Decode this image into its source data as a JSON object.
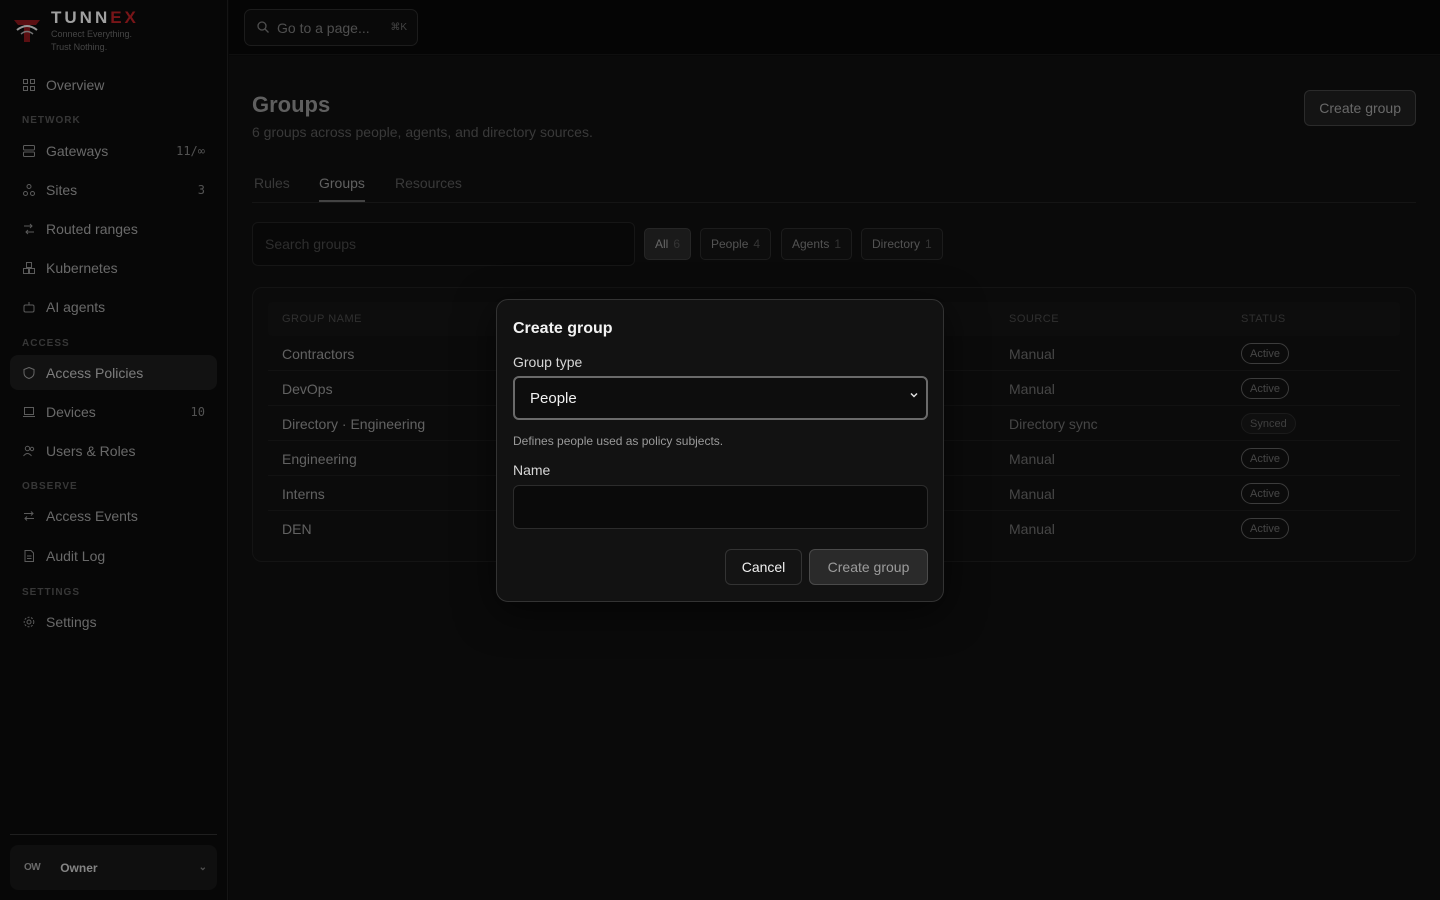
{
  "brand": {
    "name_prefix": "TUNN",
    "name_x": "EX",
    "tagline_1": "Connect Everything.",
    "tagline_2": "Trust Nothing.",
    "accent": "#a01c20"
  },
  "sidebar": {
    "overview": "Overview",
    "sections": {
      "network": "NETWORK",
      "access": "ACCESS",
      "observe": "OBSERVE",
      "settings": "SETTINGS"
    },
    "items": {
      "gateways": {
        "label": "Gateways",
        "count": "11/∞"
      },
      "sites": {
        "label": "Sites",
        "count": "3"
      },
      "routed": {
        "label": "Routed ranges"
      },
      "kubernetes": {
        "label": "Kubernetes"
      },
      "ai_agents": {
        "label": "AI agents"
      },
      "access_policies": {
        "label": "Access Policies"
      },
      "devices": {
        "label": "Devices",
        "count": "10"
      },
      "users_roles": {
        "label": "Users & Roles"
      },
      "access_events": {
        "label": "Access Events"
      },
      "audit_log": {
        "label": "Audit Log"
      },
      "settings": {
        "label": "Settings"
      }
    },
    "user": {
      "initials": "OW",
      "role": "Owner"
    }
  },
  "topbar": {
    "goto_placeholder": "Go to a page...",
    "goto_shortcut": "⌘K"
  },
  "page": {
    "title": "Groups",
    "subtitle": "6 groups across people, agents, and directory sources.",
    "create_button": "Create group",
    "tabs": [
      "Rules",
      "Groups",
      "Resources"
    ],
    "active_tab": "Groups",
    "search_placeholder": "Search groups",
    "filters": [
      {
        "label": "All",
        "count": "6"
      },
      {
        "label": "People",
        "count": "4"
      },
      {
        "label": "Agents",
        "count": "1"
      },
      {
        "label": "Directory",
        "count": "1"
      }
    ]
  },
  "table": {
    "headers": {
      "name": "GROUP NAME",
      "source": "SOURCE",
      "status": "STATUS"
    },
    "rows": [
      {
        "name": "Contractors",
        "source": "Manual",
        "status": "Active"
      },
      {
        "name": "DevOps",
        "source": "Manual",
        "status": "Active"
      },
      {
        "name": "Directory · Engineering",
        "source": "Directory sync",
        "status": "Synced"
      },
      {
        "name": "Engineering",
        "source": "Manual",
        "status": "Active"
      },
      {
        "name": "Interns",
        "source": "Manual",
        "status": "Active"
      },
      {
        "name": "DEN",
        "source": "Manual",
        "status": "Active"
      }
    ]
  },
  "modal": {
    "title": "Create group",
    "group_type_label": "Group type",
    "group_type_value": "People",
    "helper": "Defines people used as policy subjects.",
    "name_label": "Name",
    "name_value": "",
    "cancel": "Cancel",
    "submit": "Create group"
  }
}
